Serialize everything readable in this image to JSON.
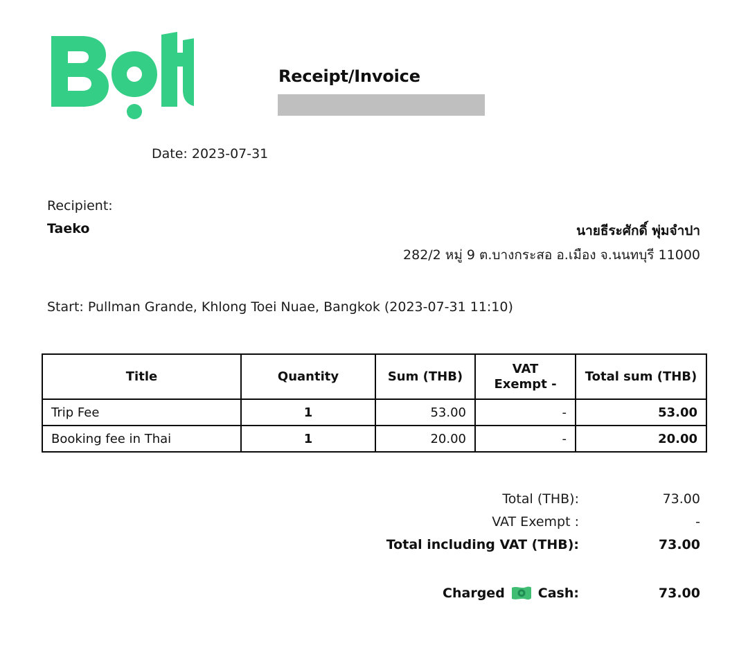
{
  "brand": {
    "name": "Bolt",
    "logo_color": "#34ce86",
    "logo_icon": "bolt-wordmark"
  },
  "header": {
    "title": "Receipt/Invoice",
    "redacted_field": "",
    "redaction_color": "#bfbfbf"
  },
  "meta": {
    "date_line": "Date: 2023-07-31"
  },
  "recipient": {
    "label": "Recipient:",
    "name": "Taeko"
  },
  "issuer": {
    "name": "นายธีระศักดิ์ พุ่มจำปา",
    "address": "282/2 หมู่ 9 ต.บางกระสอ อ.เมือง จ.นนทบุรี 11000"
  },
  "trip": {
    "start_line": "Start: Pullman Grande, Khlong Toei Nuae, Bangkok (2023-07-31 11:10)"
  },
  "items_table": {
    "columns": [
      "Title",
      "Quantity",
      "Sum (THB)",
      "VAT Exempt -",
      "Total sum (THB)"
    ],
    "vat_header_line1": "VAT",
    "vat_header_line2": "Exempt -",
    "rows": [
      {
        "title": "Trip Fee",
        "quantity": "1",
        "sum": "53.00",
        "vat": "-",
        "total": "53.00"
      },
      {
        "title": "Booking fee in Thai",
        "quantity": "1",
        "sum": "20.00",
        "vat": "-",
        "total": "20.00"
      }
    ]
  },
  "totals": {
    "rows": [
      {
        "label": "Total (THB):",
        "value": "73.00",
        "emphasis": false
      },
      {
        "label": "VAT Exempt :",
        "value": "-",
        "emphasis": false
      },
      {
        "label": "Total including VAT (THB):",
        "value": "73.00",
        "emphasis": true
      }
    ]
  },
  "charged": {
    "prefix": "Charged",
    "method": "Cash:",
    "icon": "banknote-icon",
    "icon_color": "#3fbd73",
    "icon_detail_color": "#1f8a52",
    "value": "73.00"
  }
}
